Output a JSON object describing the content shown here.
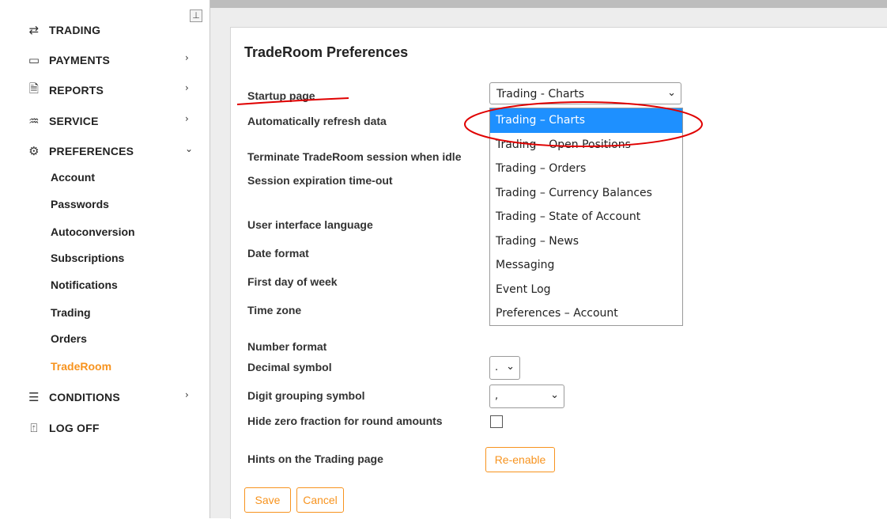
{
  "sidebar": {
    "items": [
      {
        "label": "TRADING",
        "icon": "arrows-exchange-icon"
      },
      {
        "label": "PAYMENTS",
        "icon": "wallet-icon"
      },
      {
        "label": "REPORTS",
        "icon": "document-icon"
      },
      {
        "label": "SERVICE",
        "icon": "hand-service-icon"
      },
      {
        "label": "PREFERENCES",
        "icon": "gear-icon"
      },
      {
        "label": "CONDITIONS",
        "icon": "list-icon"
      },
      {
        "label": "LOG OFF",
        "icon": "door-icon"
      }
    ],
    "sub_items": [
      "Account",
      "Passwords",
      "Autoconversion",
      "Subscriptions",
      "Notifications",
      "Trading",
      "Orders",
      "TradeRoom"
    ],
    "active_sub_item": "TradeRoom",
    "accent_color": "#f7931e"
  },
  "main": {
    "title": "TradeRoom Preferences",
    "labels": {
      "startup_page": "Startup page",
      "auto_refresh": "Automatically refresh data",
      "terminate": "Terminate TradeRoom session when idle",
      "session_timeout": "Session expiration time-out",
      "ui_language": "User interface language",
      "date_format": "Date format",
      "first_day": "First day of week",
      "time_zone": "Time zone",
      "number_format": "Number format",
      "decimal_symbol": "Decimal symbol",
      "digit_grouping": "Digit grouping symbol",
      "hide_zero": "Hide zero fraction for round amounts",
      "hints": "Hints on the Trading page"
    },
    "startup_select": {
      "value": "Trading - Charts",
      "options": [
        "Trading – Charts",
        "Trading – Open Positions",
        "Trading – Orders",
        "Trading – Currency Balances",
        "Trading – State of Account",
        "Trading – News",
        "Messaging",
        "Event Log",
        "Preferences – Account"
      ],
      "selected_index": 0,
      "highlight_color": "#1e90ff"
    },
    "decimal_symbol_value": ".",
    "digit_grouping_value": ",",
    "hide_zero_checked": false,
    "buttons": {
      "reenable": "Re-enable",
      "save": "Save",
      "cancel": "Cancel"
    },
    "annotation_color": "#e00000"
  }
}
